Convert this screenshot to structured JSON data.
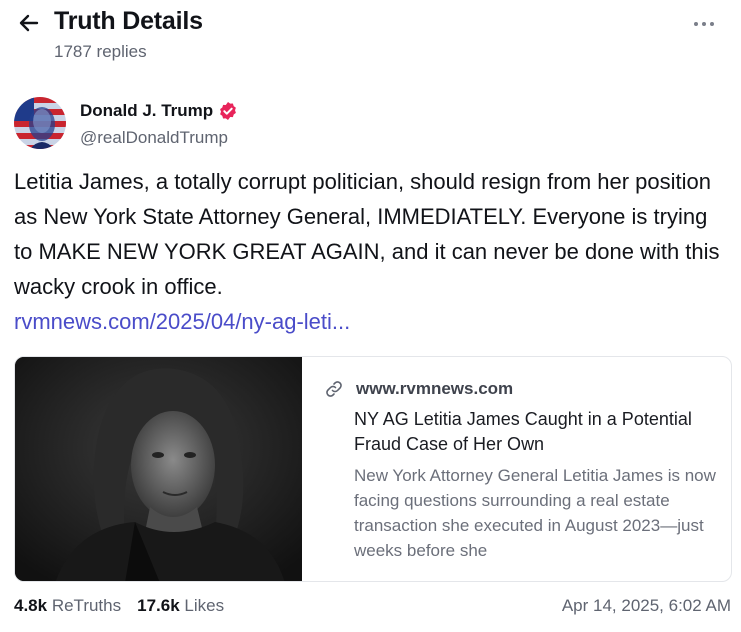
{
  "header": {
    "title": "Truth Details",
    "replies": "1787 replies",
    "back_icon": "arrow-left-icon",
    "more_icon": "ellipsis-icon"
  },
  "author": {
    "name": "Donald J. Trump",
    "handle": "@realDonaldTrump",
    "verified_color": "#e8245a"
  },
  "post": {
    "text": "Letitia James, a totally corrupt politician, should resign from her position as New York State Attorney General, IMMEDIATELY. Everyone is trying to MAKE NEW YORK GREAT AGAIN, and it can never be done with this wacky crook in office.",
    "link": "rvmnews.com/2025/04/ny-ag-leti..."
  },
  "card": {
    "domain": "www.rvmnews.com",
    "title": "NY AG Letitia James Caught in a Potential Fraud Case of Her Own",
    "description": "New York Attorney General Letitia James is now facing questions surrounding a real estate transaction she executed in August 2023—just weeks before she"
  },
  "stats": {
    "retruths_count": "4.8k",
    "retruths_label": "ReTruths",
    "likes_count": "17.6k",
    "likes_label": "Likes",
    "timestamp": "Apr 14, 2025, 6:02 AM"
  },
  "colors": {
    "link": "#4a4cc9",
    "muted": "#5f6470",
    "text": "#111318"
  }
}
